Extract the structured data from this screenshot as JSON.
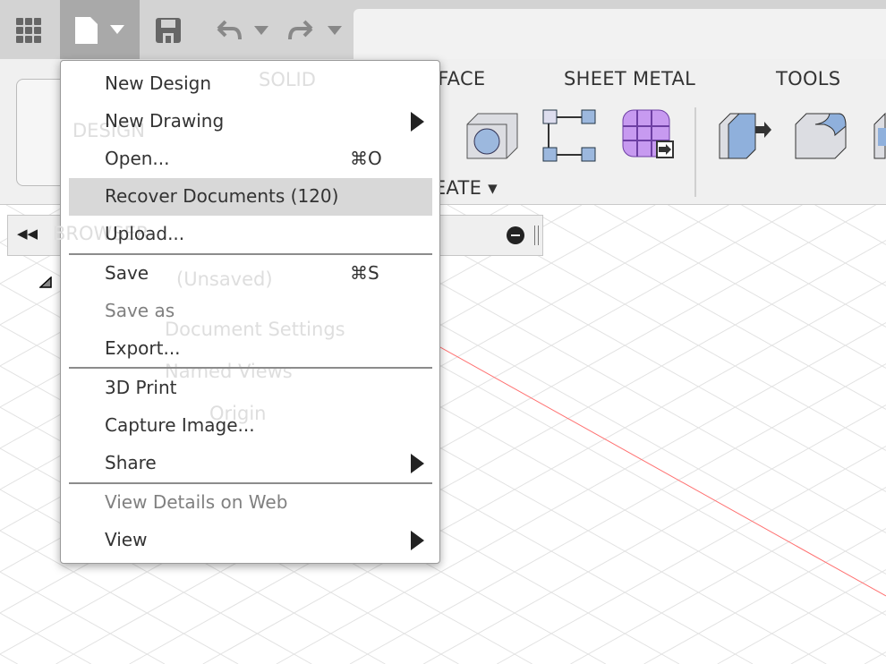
{
  "toolbar": {
    "apps_icon": "grid-icon",
    "file_icon": "document-icon",
    "save_icon": "floppy-disk-icon",
    "undo_icon": "undo-icon",
    "redo_icon": "redo-icon",
    "tabs": [
      "SOLID",
      "SURFACE",
      "SHEET METAL",
      "TOOLS"
    ],
    "workspace": "DESIGN",
    "create_label": "CREATE"
  },
  "browser": {
    "title": "BROWSER",
    "root": "(Unsaved)",
    "nodes": [
      "Document Settings",
      "Named Views",
      "Origin"
    ]
  },
  "file_menu": {
    "items": [
      {
        "label": "New Design"
      },
      {
        "label": "New Drawing",
        "submenu": true
      },
      {
        "label": "Open...",
        "shortcut": "⌘O"
      },
      {
        "label": "Recover Documents (120)",
        "highlighted": true
      },
      {
        "label": "Upload..."
      },
      {
        "label": "Save",
        "shortcut": "⌘S"
      },
      {
        "label": "Save as",
        "disabled": true
      },
      {
        "label": "Export..."
      },
      {
        "label": "3D Print"
      },
      {
        "label": "Capture Image..."
      },
      {
        "label": "Share",
        "submenu": true
      },
      {
        "label": "View Details on Web",
        "disabled": true
      },
      {
        "label": "View",
        "submenu": true
      }
    ]
  },
  "colors": {
    "highlight": "#d8d8d8",
    "x_axis": "#ff6b6b",
    "disabled_text": "#808080"
  }
}
